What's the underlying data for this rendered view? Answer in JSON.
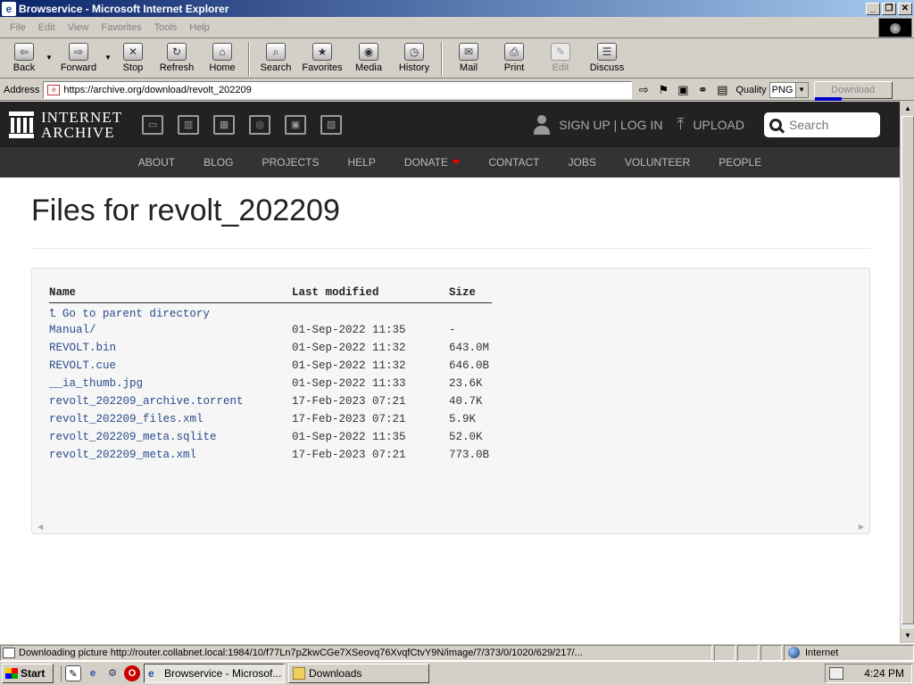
{
  "window": {
    "title": "Browservice - Microsoft Internet Explorer",
    "controls": [
      "_",
      "❐",
      "✕"
    ]
  },
  "menu": [
    "File",
    "Edit",
    "View",
    "Favorites",
    "Tools",
    "Help"
  ],
  "toolbar": {
    "back": "Back",
    "forward": "Forward",
    "stop": "Stop",
    "refresh": "Refresh",
    "home": "Home",
    "search": "Search",
    "favorites": "Favorites",
    "media": "Media",
    "history": "History",
    "mail": "Mail",
    "print": "Print",
    "edit": "Edit",
    "discuss": "Discuss"
  },
  "address": {
    "label": "Address",
    "url": "https://archive.org/download/revolt_202209",
    "quality_label": "Quality",
    "quality_value": "PNG",
    "download_label": "Download"
  },
  "ia": {
    "logo_line1": "INTERNET",
    "logo_line2": "ARCHIVE",
    "auth": "SIGN UP | LOG IN",
    "upload": "UPLOAD",
    "search_placeholder": "Search",
    "nav": [
      "ABOUT",
      "BLOG",
      "PROJECTS",
      "HELP",
      "DONATE",
      "CONTACT",
      "JOBS",
      "VOLUNTEER",
      "PEOPLE"
    ]
  },
  "page": {
    "title": "Files for revolt_202209",
    "columns": [
      "Name",
      "Last modified",
      "Size"
    ],
    "parent_link": "Go to parent directory",
    "files": [
      {
        "name": "Manual/",
        "modified": "01-Sep-2022 11:35",
        "size": "-"
      },
      {
        "name": "REVOLT.bin",
        "modified": "01-Sep-2022 11:32",
        "size": "643.0M"
      },
      {
        "name": "REVOLT.cue",
        "modified": "01-Sep-2022 11:32",
        "size": "646.0B"
      },
      {
        "name": "__ia_thumb.jpg",
        "modified": "01-Sep-2022 11:33",
        "size": "23.6K"
      },
      {
        "name": "revolt_202209_archive.torrent",
        "modified": "17-Feb-2023 07:21",
        "size": "40.7K"
      },
      {
        "name": "revolt_202209_files.xml",
        "modified": "17-Feb-2023 07:21",
        "size": "5.9K"
      },
      {
        "name": "revolt_202209_meta.sqlite",
        "modified": "01-Sep-2022 11:35",
        "size": "52.0K"
      },
      {
        "name": "revolt_202209_meta.xml",
        "modified": "17-Feb-2023 07:21",
        "size": "773.0B"
      }
    ]
  },
  "status": {
    "text": "Downloading picture http://router.collabnet.local:1984/10/f77Ln7pZkwCGe7XSeovq76XvqfCtvY9N/image/7/373/0/1020/629/217/...",
    "zone": "Internet"
  },
  "taskbar": {
    "start": "Start",
    "tasks": [
      "Browservice - Microsof...",
      "Downloads"
    ],
    "clock": "4:24 PM"
  }
}
